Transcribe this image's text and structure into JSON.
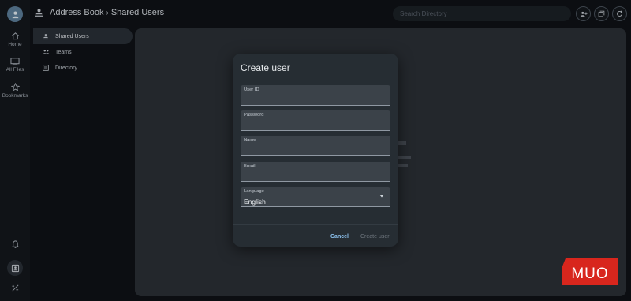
{
  "rail": {
    "items": [
      {
        "label": "Home",
        "icon": "home-icon"
      },
      {
        "label": "All Files",
        "icon": "files-icon"
      },
      {
        "label": "Bookmarks",
        "icon": "star-icon"
      }
    ],
    "bottom_icons": [
      "bell-icon",
      "contacts-icon",
      "settings-icon"
    ]
  },
  "header": {
    "crumb_root": "Address Book",
    "crumb_separator": "›",
    "crumb_current": "Shared Users",
    "search_placeholder": "Search Directory"
  },
  "subnav": {
    "items": [
      {
        "label": "Shared Users",
        "active": true
      },
      {
        "label": "Teams",
        "active": false
      },
      {
        "label": "Directory",
        "active": false
      }
    ]
  },
  "dialog": {
    "title": "Create user",
    "fields": [
      {
        "label": "User ID",
        "value": ""
      },
      {
        "label": "Password",
        "value": ""
      },
      {
        "label": "Name",
        "value": ""
      },
      {
        "label": "Email",
        "value": ""
      },
      {
        "label": "Language",
        "value": "English"
      }
    ],
    "cancel_label": "Cancel",
    "create_label": "Create user"
  },
  "watermark": "MUO",
  "colors": {
    "accent": "#8ec4f2",
    "watermark_red": "#d8261d",
    "panel": "#2b3036",
    "dialog": "#262d33"
  }
}
